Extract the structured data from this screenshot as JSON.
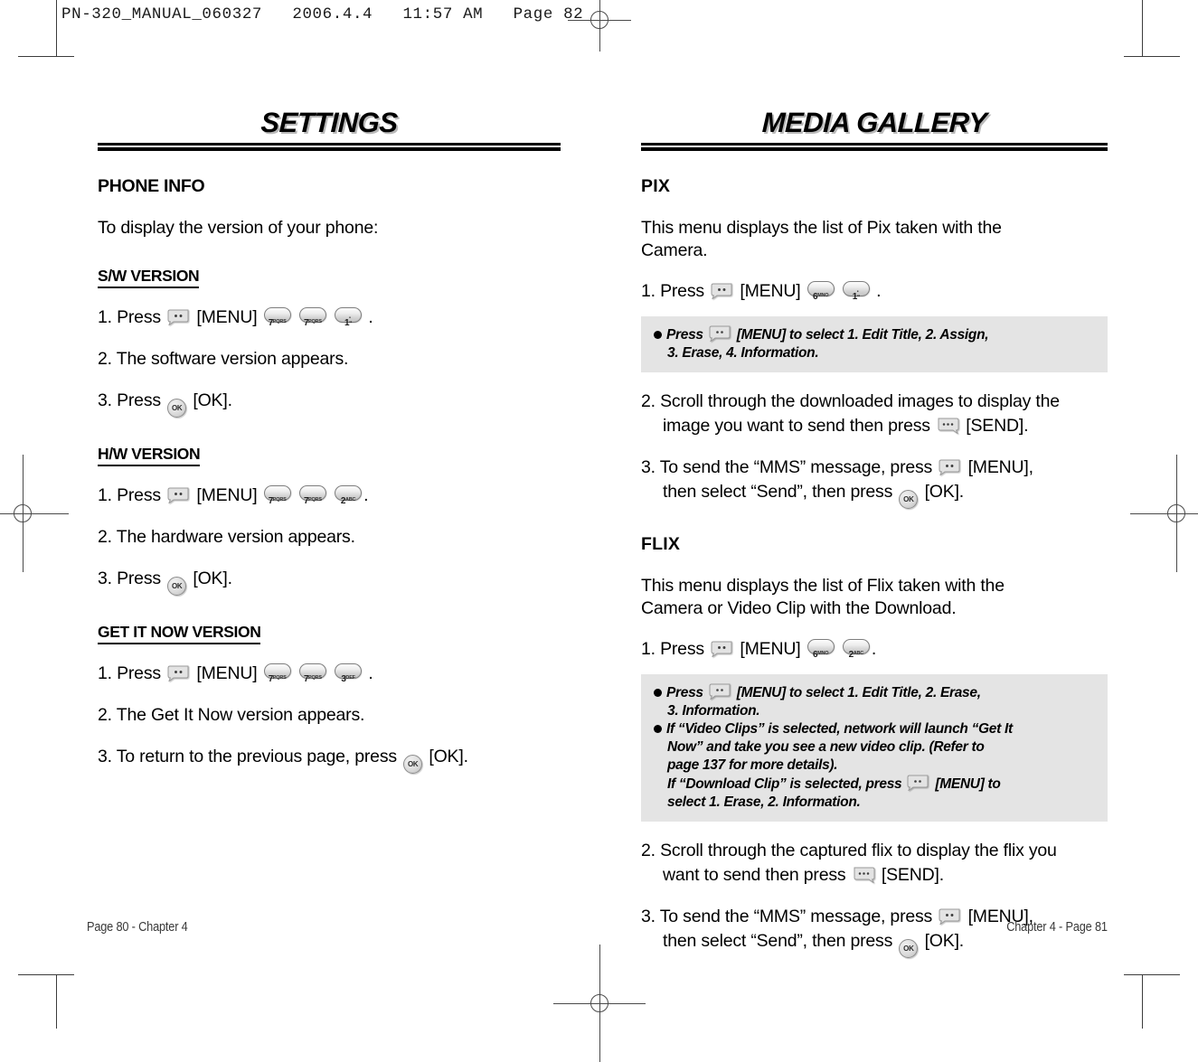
{
  "scan_header": "PN-320_MANUAL_060327   2006.4.4   11:57 AM   Page 82",
  "left_page": {
    "chapter_title": "SETTINGS",
    "section_title": "PHONE INFO",
    "intro": "To display the version of your phone:",
    "subsections": [
      {
        "heading": "S/W VERSION",
        "steps": [
          {
            "num": "1. Press",
            "keys": [
              "menu-key",
              "[MENU]",
              "key-7",
              "key-7",
              "key-1"
            ],
            "tail": "."
          },
          {
            "text": "2. The software version appears."
          },
          {
            "num": "3. Press",
            "keys": [
              "ok-key",
              "[OK]"
            ],
            "tail": "."
          }
        ]
      },
      {
        "heading": "H/W VERSION",
        "steps": [
          {
            "num": "1. Press",
            "keys": [
              "menu-key",
              "[MENU]",
              "key-7",
              "key-7",
              "key-2"
            ],
            "tail": "."
          },
          {
            "text": "2. The hardware version appears."
          },
          {
            "num": "3. Press",
            "keys": [
              "ok-key",
              "[OK]"
            ],
            "tail": "."
          }
        ]
      },
      {
        "heading": "GET IT NOW VERSION",
        "steps": [
          {
            "num": "1. Press",
            "keys": [
              "menu-key",
              "[MENU]",
              "key-7",
              "key-7",
              "key-3"
            ],
            "tail": "."
          },
          {
            "text": "2. The Get It Now version appears."
          },
          {
            "num": "3. To return to the previous page, press",
            "keys": [
              "ok-key",
              "[OK]"
            ],
            "tail": "."
          }
        ]
      }
    ],
    "footer": "Page 80 - Chapter 4"
  },
  "right_page": {
    "chapter_title": "MEDIA GALLERY",
    "footer": "Chapter 4 - Page 81",
    "sections": [
      {
        "heading": "PIX",
        "intro_line1": "This menu displays the list of Pix taken with the",
        "intro_line2": "Camera.",
        "step1_lead": "1. Press",
        "step1_menu_label": "[MENU]",
        "step1_tail": ".",
        "note": {
          "line1_pre": "Press",
          "line1_post": "[MENU] to select 1. Edit Title, 2. Assign,",
          "line2": "3. Erase, 4. Information."
        },
        "step2_line1": "2. Scroll through the downloaded images to display the",
        "step2_line2_pre": "image you want to send then press",
        "step2_line2_post": "[SEND].",
        "step3_line1_pre": "3. To send the “MMS” message, press",
        "step3_line1_post": "[MENU],",
        "step3_line2_pre": "then select “Send”, then press",
        "step3_line2_post": "[OK]."
      },
      {
        "heading": "FLIX",
        "intro_line1": "This menu displays the list of Flix taken with the",
        "intro_line2": "Camera or Video Clip with the Download.",
        "step1_lead": "1. Press",
        "step1_menu_label": "[MENU]",
        "step1_tail": ".",
        "note": {
          "b1_line1_pre": "Press",
          "b1_line1_post": "[MENU] to select 1. Edit Title, 2. Erase,",
          "b1_line2": "3. Information.",
          "b2_line1": "If “Video Clips” is selected, network will launch “Get It",
          "b2_line2": "Now” and take you see a new video clip. (Refer to",
          "b2_line3": "page 137 for more details).",
          "b2_line4_pre": "If “Download Clip” is selected, press",
          "b2_line4_post": "[MENU] to",
          "b2_line5": "select 1. Erase, 2. Information."
        },
        "step2_line1": "2. Scroll through the captured flix to display the flix you",
        "step2_line2_pre": "want to send then press",
        "step2_line2_post": "[SEND].",
        "step3_line1_pre": "3. To send the “MMS” message, press",
        "step3_line1_post": "[MENU],",
        "step3_line2_pre": "then select “Send”, then press",
        "step3_line2_post": "[OK]."
      }
    ]
  },
  "keys": {
    "key_1_digit": "1",
    "key_1_sub_top": "•",
    "key_1_sub_bottom": "••",
    "key_2_digit": "2",
    "key_2_sub": "ABC",
    "key_3_digit": "3",
    "key_3_sub": "DEF",
    "key_6_digit": "6",
    "key_6_sub": "MNO",
    "key_7_digit": "7",
    "key_7_sub": "PQRS",
    "ok_label": "OK"
  },
  "labels": {
    "menu_bracket": "[MENU]",
    "send_bracket": "[SEND]",
    "ok_bracket": "[OK]",
    "press": "Press",
    "dot": "."
  }
}
